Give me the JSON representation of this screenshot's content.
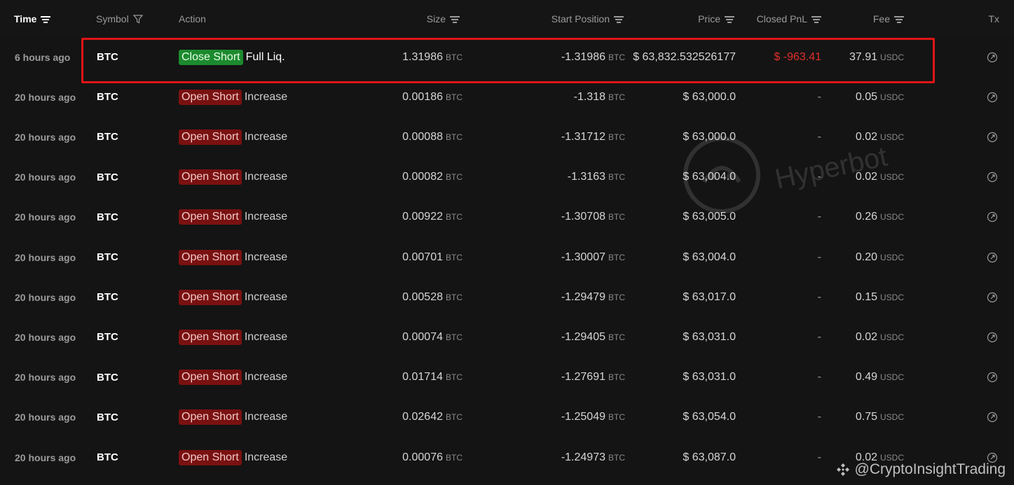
{
  "header": {
    "time": "Time",
    "symbol": "Symbol",
    "action": "Action",
    "size": "Size",
    "start_position": "Start Position",
    "price": "Price",
    "closed_pnl": "Closed PnL",
    "fee": "Fee",
    "tx": "Tx"
  },
  "rows": [
    {
      "time": "6 hours ago",
      "symbol": "BTC",
      "badge": "Close Short",
      "badge_type": "green",
      "action_sub": "Full Liq.",
      "size": "1.31986",
      "size_unit": "BTC",
      "start_position": "-1.31986",
      "start_unit": "BTC",
      "price": "$ 63,832.532526177",
      "pnl": "$ -963.41",
      "fee": "37.91",
      "fee_unit": "USDC"
    },
    {
      "time": "20 hours ago",
      "symbol": "BTC",
      "badge": "Open Short",
      "badge_type": "red",
      "action_sub": "Increase",
      "size": "0.00186",
      "size_unit": "BTC",
      "start_position": "-1.318",
      "start_unit": "BTC",
      "price": "$ 63,000.0",
      "pnl": "-",
      "fee": "0.05",
      "fee_unit": "USDC"
    },
    {
      "time": "20 hours ago",
      "symbol": "BTC",
      "badge": "Open Short",
      "badge_type": "red",
      "action_sub": "Increase",
      "size": "0.00088",
      "size_unit": "BTC",
      "start_position": "-1.31712",
      "start_unit": "BTC",
      "price": "$ 63,000.0",
      "pnl": "-",
      "fee": "0.02",
      "fee_unit": "USDC"
    },
    {
      "time": "20 hours ago",
      "symbol": "BTC",
      "badge": "Open Short",
      "badge_type": "red",
      "action_sub": "Increase",
      "size": "0.00082",
      "size_unit": "BTC",
      "start_position": "-1.3163",
      "start_unit": "BTC",
      "price": "$ 63,004.0",
      "pnl": "-",
      "fee": "0.02",
      "fee_unit": "USDC"
    },
    {
      "time": "20 hours ago",
      "symbol": "BTC",
      "badge": "Open Short",
      "badge_type": "red",
      "action_sub": "Increase",
      "size": "0.00922",
      "size_unit": "BTC",
      "start_position": "-1.30708",
      "start_unit": "BTC",
      "price": "$ 63,005.0",
      "pnl": "-",
      "fee": "0.26",
      "fee_unit": "USDC"
    },
    {
      "time": "20 hours ago",
      "symbol": "BTC",
      "badge": "Open Short",
      "badge_type": "red",
      "action_sub": "Increase",
      "size": "0.00701",
      "size_unit": "BTC",
      "start_position": "-1.30007",
      "start_unit": "BTC",
      "price": "$ 63,004.0",
      "pnl": "-",
      "fee": "0.20",
      "fee_unit": "USDC"
    },
    {
      "time": "20 hours ago",
      "symbol": "BTC",
      "badge": "Open Short",
      "badge_type": "red",
      "action_sub": "Increase",
      "size": "0.00528",
      "size_unit": "BTC",
      "start_position": "-1.29479",
      "start_unit": "BTC",
      "price": "$ 63,017.0",
      "pnl": "-",
      "fee": "0.15",
      "fee_unit": "USDC"
    },
    {
      "time": "20 hours ago",
      "symbol": "BTC",
      "badge": "Open Short",
      "badge_type": "red",
      "action_sub": "Increase",
      "size": "0.00074",
      "size_unit": "BTC",
      "start_position": "-1.29405",
      "start_unit": "BTC",
      "price": "$ 63,031.0",
      "pnl": "-",
      "fee": "0.02",
      "fee_unit": "USDC"
    },
    {
      "time": "20 hours ago",
      "symbol": "BTC",
      "badge": "Open Short",
      "badge_type": "red",
      "action_sub": "Increase",
      "size": "0.01714",
      "size_unit": "BTC",
      "start_position": "-1.27691",
      "start_unit": "BTC",
      "price": "$ 63,031.0",
      "pnl": "-",
      "fee": "0.49",
      "fee_unit": "USDC"
    },
    {
      "time": "20 hours ago",
      "symbol": "BTC",
      "badge": "Open Short",
      "badge_type": "red",
      "action_sub": "Increase",
      "size": "0.02642",
      "size_unit": "BTC",
      "start_position": "-1.25049",
      "start_unit": "BTC",
      "price": "$ 63,054.0",
      "pnl": "-",
      "fee": "0.75",
      "fee_unit": "USDC"
    },
    {
      "time": "20 hours ago",
      "symbol": "BTC",
      "badge": "Open Short",
      "badge_type": "red",
      "action_sub": "Increase",
      "size": "0.00076",
      "size_unit": "BTC",
      "start_position": "-1.24973",
      "start_unit": "BTC",
      "price": "$ 63,087.0",
      "pnl": "-",
      "fee": "0.02",
      "fee_unit": "USDC"
    }
  ],
  "watermark": "Hyperbot",
  "source_tag": "@CryptoInsightTrading",
  "colors": {
    "background": "#141414",
    "green_badge": "#1c8a2e",
    "red_badge": "#7a1111",
    "negative_pnl": "#e0302a",
    "highlight_border": "#e01515"
  },
  "icons": {
    "sort": "sort-lines-icon",
    "filter": "funnel-icon",
    "tx": "external-link-icon"
  }
}
